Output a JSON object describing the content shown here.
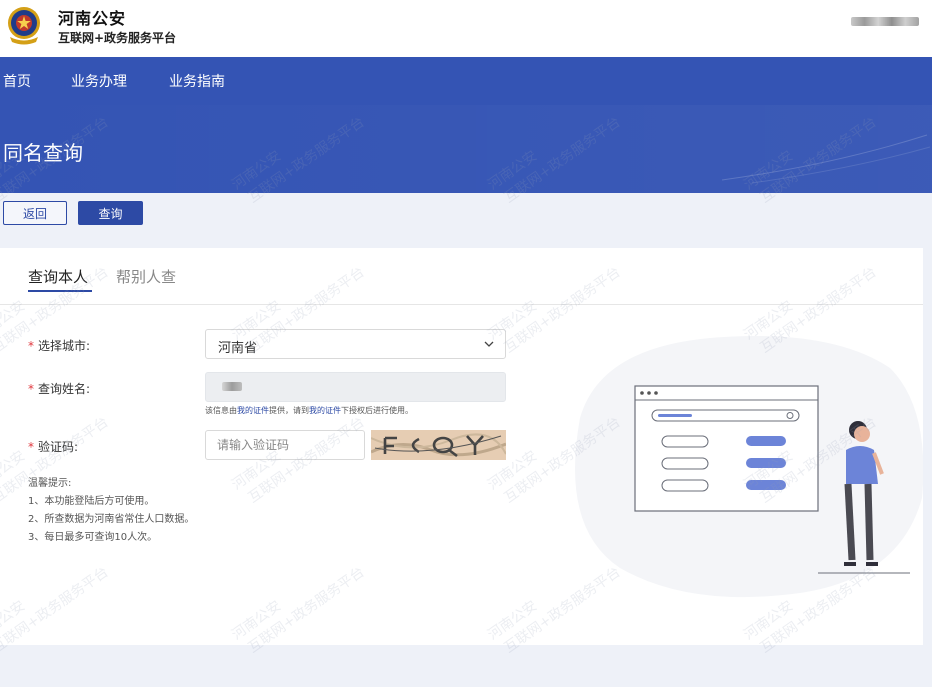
{
  "header": {
    "site_name": "河南公安",
    "site_sub": "互联网+政务服务平台",
    "emblem_icon": "police-emblem-icon"
  },
  "nav": {
    "items": [
      {
        "label": "首页"
      },
      {
        "label": "业务办理"
      },
      {
        "label": "业务指南"
      }
    ]
  },
  "banner": {
    "title": "同名查询"
  },
  "actions": {
    "back_label": "返回",
    "query_label": "查询"
  },
  "tabs": [
    {
      "label": "查询本人",
      "active": true
    },
    {
      "label": "帮别人查",
      "active": false
    }
  ],
  "form": {
    "required_mark": "*",
    "city_label": "选择城市:",
    "city_value": "河南省",
    "name_label": "查询姓名:",
    "name_hint_prefix": "该信息由",
    "name_hint_link1": "我的证件",
    "name_hint_mid": "提供，请到",
    "name_hint_link2": "我的证件",
    "name_hint_suffix": "下授权后进行使用。",
    "captcha_label": "验证码:",
    "captcha_placeholder": "请输入验证码"
  },
  "tips": {
    "title": "温馨提示:",
    "lines": [
      "1、本功能登陆后方可使用。",
      "2、所查数据为河南省常住人口数据。",
      "3、每日最多可查询10人次。"
    ]
  },
  "watermark": {
    "line1": "河南公安",
    "line2": "互联网+政务服务平台"
  },
  "colors": {
    "primary": "#3454b4",
    "button": "#2d4aa5",
    "required": "#e0383e",
    "page_bg": "#eef1f8"
  }
}
